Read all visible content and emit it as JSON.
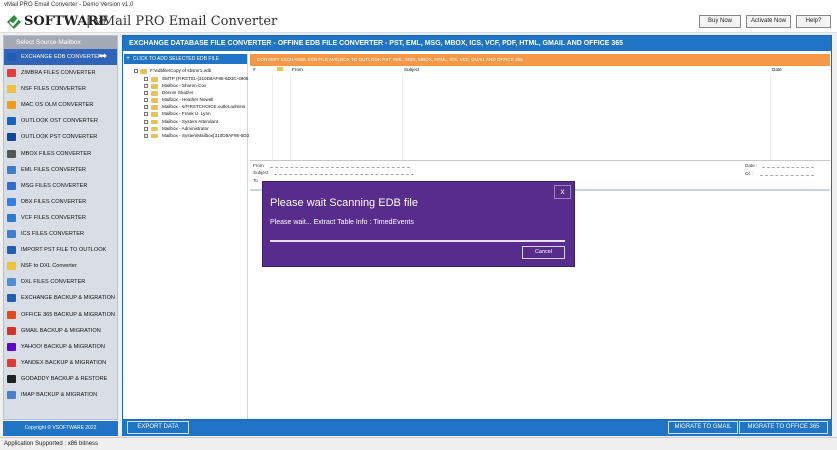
{
  "window": {
    "title": "vMail PRO Email Converter - Demo Version v1.0"
  },
  "header": {
    "brand": "SOFTWARE",
    "product": "| vMail PRO Email Converter",
    "buttons": [
      "Buy Now",
      "Activate Now",
      "Help?"
    ]
  },
  "sidebar": {
    "heading": "Select Source Mailbox",
    "items": [
      {
        "label": "EXCHANGE EDB CONVERTER",
        "icon": "exchange-icon",
        "color": "#1f5fb0"
      },
      {
        "label": "ZIMBRA FILES CONVERTER",
        "icon": "zimbra-icon",
        "color": "#e83c3c"
      },
      {
        "label": "NSF FILES CONVERTER",
        "icon": "lotus-notes-icon",
        "color": "#f1c232"
      },
      {
        "label": "MAC OS OLM CONVERTER",
        "icon": "mac-olm-icon",
        "color": "#f39c12"
      },
      {
        "label": "OUTLOOK OST CONVERTER",
        "icon": "outlook-ost-icon",
        "color": "#1565c0"
      },
      {
        "label": "OUTLOOK PST CONVERTER",
        "icon": "outlook-pst-icon",
        "color": "#0d47a1"
      },
      {
        "label": "MBOX FILES CONVERTER",
        "icon": "mbox-icon",
        "color": "#555555"
      },
      {
        "label": "EML FILES CONVERTER",
        "icon": "eml-icon",
        "color": "#3d7ecb"
      },
      {
        "label": "MSG FILES CONVERTER",
        "icon": "msg-icon",
        "color": "#2e6fd1"
      },
      {
        "label": "DBX FILES CONVERTER",
        "icon": "dbx-icon",
        "color": "#2f80ed"
      },
      {
        "label": "VCF FILES CONVERTER",
        "icon": "vcf-icon",
        "color": "#2a7ad6"
      },
      {
        "label": "ICS FILES CONVERTER",
        "icon": "ics-icon",
        "color": "#3b82d6"
      },
      {
        "label": "IMPORT PST FILE TO OUTLOOK",
        "icon": "import-pst-icon",
        "color": "#1e5fb4"
      },
      {
        "label": "NSF to DXL Converter",
        "icon": "nsf-dxl-icon",
        "color": "#f1c232"
      },
      {
        "label": "DXL FILES CONVERTER",
        "icon": "dxl-icon",
        "color": "#4f8fd8"
      },
      {
        "label": "EXCHANGE BACKUP & MIGRATION",
        "icon": "exchange-backup-icon",
        "color": "#1e5fb4"
      },
      {
        "label": "OFFICE 365 BACKUP & MIGRATION",
        "icon": "office365-icon",
        "color": "#e8491d"
      },
      {
        "label": "GMAIL BACKUP & MIGRATION",
        "icon": "gmail-icon",
        "color": "#d93025"
      },
      {
        "label": "YAHOO! BACKUP & MIGRATION",
        "icon": "yahoo-icon",
        "color": "#6001d2"
      },
      {
        "label": "YANDEX BACKUP & MIGRATION",
        "icon": "yandex-icon",
        "color": "#e53935"
      },
      {
        "label": "GODADDY BACKUP & RESTORE",
        "icon": "godaddy-icon",
        "color": "#222222"
      },
      {
        "label": "IMAP BACKUP & MIGRATION",
        "icon": "imap-icon",
        "color": "#4a7fd0"
      }
    ],
    "copyright": "Copyright © VSOFTWARE 2022"
  },
  "main": {
    "title": "EXCHANGE DATABASE FILE CONVERTER - OFFINE EDB FILE CONVERTER - PST, EML, MSG, MBOX, ICS, VCF, PDF, HTML, GMAIL AND OFFICE 365",
    "add_button": "CLICK TO ADD SELECTED EDB FILE",
    "tree": {
      "root": "F:\\edbfile\\Copy of sbsmr1.edb",
      "children": [
        "SMTP (FIRST01-{310D8AF95-6D3C-4905",
        "Mailbox - Sharon Cox",
        "Dennis Shatzer",
        "Mailbox - Heather Nowell",
        "Mailbox - s/FIRSTCHOICE.outlet.admins",
        "Mailbox - Frank U. Lynn",
        "Mailbox - System Attendant",
        "Mailbox - Administrator",
        "Mailbox - SystemMailbox{310D8AF95-6D3"
      ]
    },
    "banner": "CONVERT EXCHANGE EDB FILE MAILBOX TO OUTLOOK PST, EML, MSG, MBOX, HTML, ICS, VCF, GMAIL AND OFFICE 365",
    "columns": {
      "id": "#",
      "from": "From",
      "subject": "Subject",
      "date": "Date"
    },
    "preview": {
      "from": "From",
      "subject": "Subject",
      "to": "To",
      "date": "Date :",
      "cc": "Cc :"
    }
  },
  "dialog": {
    "title": "Please wait Scanning EDB file",
    "message": "Please wait... Extract Table Info : TimedEvents",
    "close": "x",
    "cancel": "Cancel"
  },
  "footer": {
    "export": "EXPORT DATA",
    "gmail": "MIGRATE TO GMAIL",
    "office": "MIGRATE TO OFFICE 365"
  },
  "status": "Application Supported :  x86 bitness"
}
